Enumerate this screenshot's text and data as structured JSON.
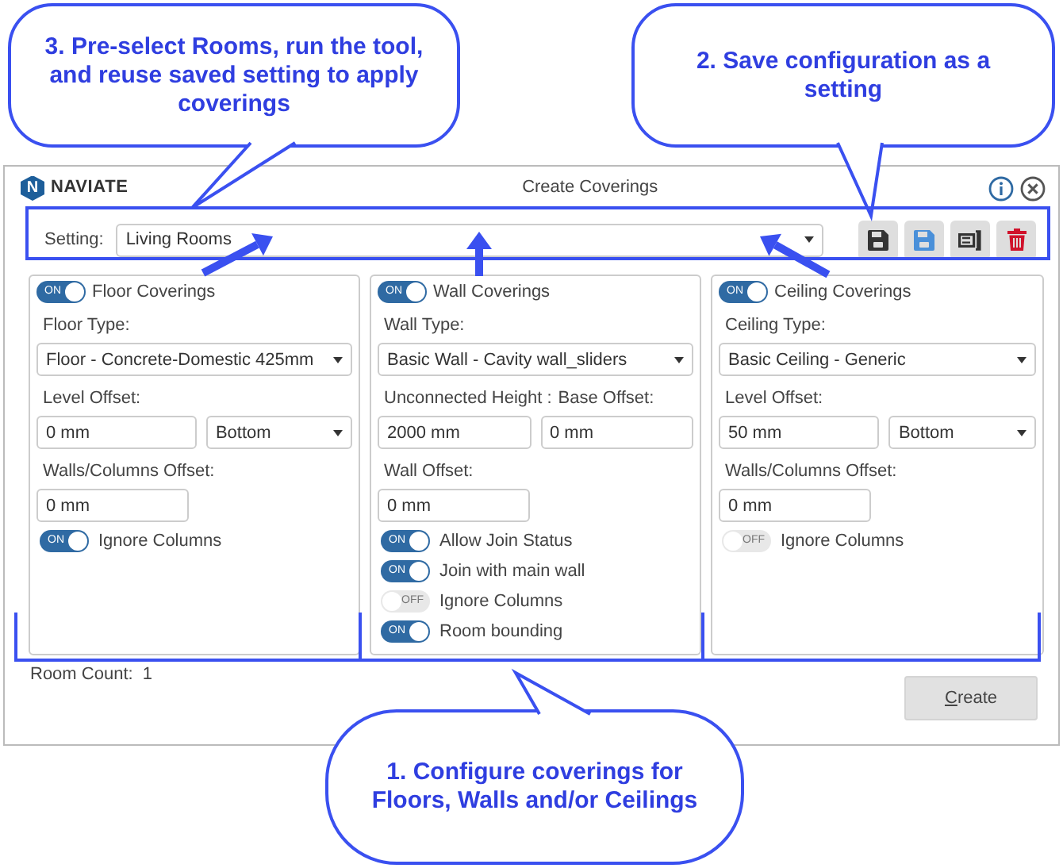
{
  "callouts": [
    {
      "text": "3. Pre-select Rooms, run the tool, and reuse saved setting to apply coverings"
    },
    {
      "text": "2. Save configuration as a setting"
    },
    {
      "text": "1. Configure coverings for Floors, Walls and/or Ceilings"
    }
  ],
  "window": {
    "logo_mark": "N",
    "logo_text": "NAVIATE",
    "title": "Create Coverings"
  },
  "setting": {
    "label": "Setting:",
    "value": "Living Rooms"
  },
  "panels": [
    {
      "on": true,
      "switch_text": "ON",
      "title": "Floor Coverings",
      "rows": [
        {
          "kind": "label",
          "texts": [
            "Floor Type:"
          ]
        },
        {
          "kind": "select",
          "value": "Floor - Concrete-Domestic 425mm"
        },
        {
          "kind": "label",
          "texts": [
            "Level Offset:"
          ]
        },
        {
          "kind": "input-select",
          "value": "0 mm",
          "option": "Bottom"
        },
        {
          "kind": "label",
          "texts": [
            "Walls/Columns Offset:"
          ]
        },
        {
          "kind": "input",
          "value": "0 mm"
        },
        {
          "kind": "toggle",
          "on": true,
          "switch_text": "ON",
          "label": "Ignore Columns"
        }
      ]
    },
    {
      "on": true,
      "switch_text": "ON",
      "title": "Wall Coverings",
      "rows": [
        {
          "kind": "label",
          "texts": [
            "Wall Type:"
          ]
        },
        {
          "kind": "select",
          "value": "Basic Wall - Cavity wall_sliders"
        },
        {
          "kind": "label",
          "texts": [
            "Unconnected Height :",
            "Base Offset:"
          ]
        },
        {
          "kind": "input-pair",
          "values": [
            "2000 mm",
            "0 mm"
          ]
        },
        {
          "kind": "label",
          "texts": [
            "Wall Offset:"
          ]
        },
        {
          "kind": "input",
          "value": "0 mm"
        },
        {
          "kind": "toggle",
          "on": true,
          "switch_text": "ON",
          "label": "Allow Join Status"
        },
        {
          "kind": "toggle",
          "on": true,
          "switch_text": "ON",
          "label": "Join with main wall"
        },
        {
          "kind": "toggle",
          "on": false,
          "switch_text": "OFF",
          "label": "Ignore Columns"
        },
        {
          "kind": "toggle",
          "on": true,
          "switch_text": "ON",
          "label": "Room bounding"
        }
      ]
    },
    {
      "on": true,
      "switch_text": "ON",
      "title": "Ceiling Coverings",
      "rows": [
        {
          "kind": "label",
          "texts": [
            "Ceiling Type:"
          ]
        },
        {
          "kind": "select",
          "value": "Basic Ceiling - Generic"
        },
        {
          "kind": "label",
          "texts": [
            "Level Offset:"
          ]
        },
        {
          "kind": "input-select",
          "value": "50 mm",
          "option": "Bottom"
        },
        {
          "kind": "label",
          "texts": [
            "Walls/Columns Offset:"
          ]
        },
        {
          "kind": "input",
          "value": "0 mm"
        },
        {
          "kind": "toggle",
          "on": false,
          "switch_text": "OFF",
          "label": "Ignore Columns"
        }
      ]
    }
  ],
  "room_count": "Room Count:  1",
  "create_button": "Create"
}
